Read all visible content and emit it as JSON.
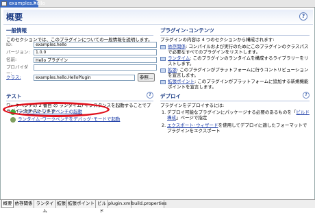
{
  "editor_tab": {
    "label": "examples.hello",
    "close": "✕"
  },
  "page": {
    "title": "概要",
    "help": "?"
  },
  "general": {
    "title": "一般情報",
    "desc": "このセクションでは、このプラグインについての一般情報を説明します。",
    "fields": [
      {
        "label": "ID:",
        "value": "examples.hello"
      },
      {
        "label": "バージョン:",
        "value": "1.0.0"
      },
      {
        "label": "名前:",
        "value": "Hello プラグイン"
      },
      {
        "label": "プロバイダー:",
        "value": ""
      }
    ],
    "class_label": "クラス:",
    "class_value": "examples.hello.HelloPlugin",
    "browse": "参照..."
  },
  "content": {
    "title": "プラグイン･コンテンツ",
    "desc": "プラグインの内容は 4 つのセクションから構成されます:",
    "items": [
      {
        "link": "依存関係",
        "text": ": コンパイルおよび実行のためにこのプラグインのクラスパスで必要なすべてのプラグインをリストします。"
      },
      {
        "link": "ランタイム",
        "text": ": このプラグインのランタイムを構成するライブラリーをリストします。"
      },
      {
        "link": "拡張",
        "text": ": このプラグインがプラットフォームに行うコントリビューションを宣言します。"
      },
      {
        "link": "拡張ポイント",
        "text": ": このプラグインがプラットフォームに追加する新規機能ポイントを宣言します。"
      }
    ]
  },
  "testing": {
    "title": "テスト",
    "desc": "ワークベンチの 2 番目 の ランタイム) インスタンスを起動することでプラグインをテストします:",
    "link1": "ランタイム･ワークベンチの起動",
    "link2": "ランタイム･ワークベンチをデバッグ･モードで起動"
  },
  "deploy": {
    "title": "デプロイ",
    "desc": "プラグインをデプロイするには:",
    "steps": [
      {
        "num": "1.",
        "pre": "デプロイ可能なプラグインにパッケージする必要のあるものを「",
        "link": "ビルド構成",
        "post": "」ページで指定"
      },
      {
        "num": "2.",
        "pre": "",
        "link": "エクスポート･ウィザード",
        "post": "を使用してデプロイに適したフォーマットでプラグインをエクスポート"
      }
    ]
  },
  "bottom_tabs": [
    "概要",
    "依存関係",
    "ランタイム",
    "拡張",
    "拡張ポイント",
    "ビルド",
    "plugin.xml",
    "build.properties"
  ]
}
